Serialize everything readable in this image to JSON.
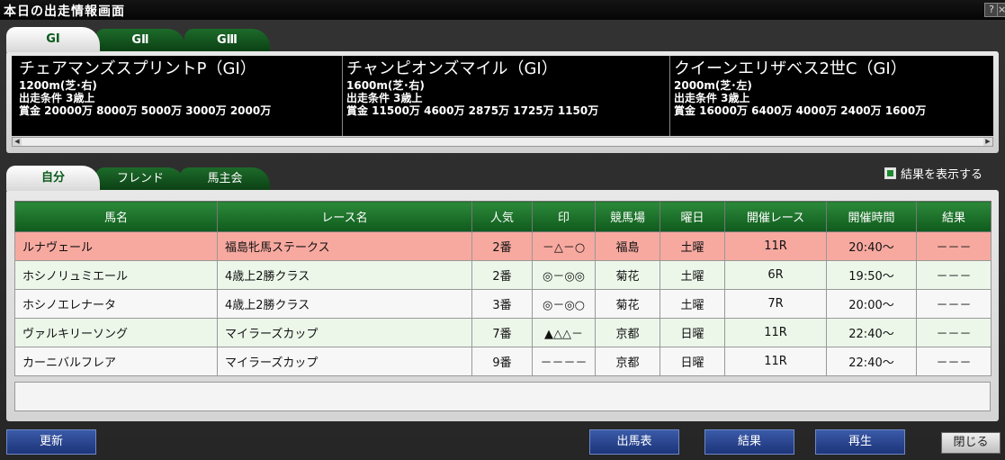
{
  "window": {
    "title": "本日の出走情報画面",
    "help": "?",
    "close": "×"
  },
  "grade_tabs": [
    "GⅠ",
    "GⅡ",
    "GⅢ"
  ],
  "races": [
    {
      "name": "チェアマンズスプリントP（GⅠ）",
      "distance": "1200m(芝･右)",
      "condition": "出走条件 3歳上",
      "prize": "賞金 20000万 8000万 5000万 3000万 2000万"
    },
    {
      "name": "チャンピオンズマイル（GⅠ）",
      "distance": "1600m(芝･右)",
      "condition": "出走条件 3歳上",
      "prize": "賞金 11500万 4600万 2875万 1725万 1150万"
    },
    {
      "name": "クイーンエリザベス2世C（GⅠ）",
      "distance": "2000m(芝･左)",
      "condition": "出走条件 3歳上",
      "prize": "賞金 16000万 6400万 4000万 2400万 1600万"
    }
  ],
  "scroll": {
    "left": "◀",
    "right": "▶"
  },
  "friend_tabs": [
    "自分",
    "フレンド",
    "馬主会"
  ],
  "show_results": "結果を表示する",
  "table": {
    "headers": [
      "馬名",
      "レース名",
      "人気",
      "印",
      "競馬場",
      "曜日",
      "開催レース",
      "開催時間",
      "結果"
    ],
    "rows": [
      {
        "horse": "ルナヴェール",
        "race": "福島牝馬ステークス",
        "pop": "2番",
        "mark": "－△－○",
        "track": "福島",
        "day": "土曜",
        "raceno": "11R",
        "time": "20:40～",
        "result": "－－－"
      },
      {
        "horse": "ホシノリュミエール",
        "race": "4歳上2勝クラス",
        "pop": "2番",
        "mark": "◎－◎◎",
        "track": "菊花",
        "day": "土曜",
        "raceno": "6R",
        "time": "19:50～",
        "result": "－－－"
      },
      {
        "horse": "ホシノエレナータ",
        "race": "4歳上2勝クラス",
        "pop": "3番",
        "mark": "◎－◎○",
        "track": "菊花",
        "day": "土曜",
        "raceno": "7R",
        "time": "20:00～",
        "result": "－－－"
      },
      {
        "horse": "ヴァルキリーソング",
        "race": "マイラーズカップ",
        "pop": "7番",
        "mark": "▲△△－",
        "track": "京都",
        "day": "日曜",
        "raceno": "11R",
        "time": "22:40～",
        "result": "－－－"
      },
      {
        "horse": "カーニバルフレア",
        "race": "マイラーズカップ",
        "pop": "9番",
        "mark": "－－－－",
        "track": "京都",
        "day": "日曜",
        "raceno": "11R",
        "time": "22:40～",
        "result": "－－－"
      }
    ]
  },
  "buttons": {
    "refresh": "更新",
    "entries": "出馬表",
    "results": "結果",
    "replay": "再生",
    "close": "閉じる"
  }
}
